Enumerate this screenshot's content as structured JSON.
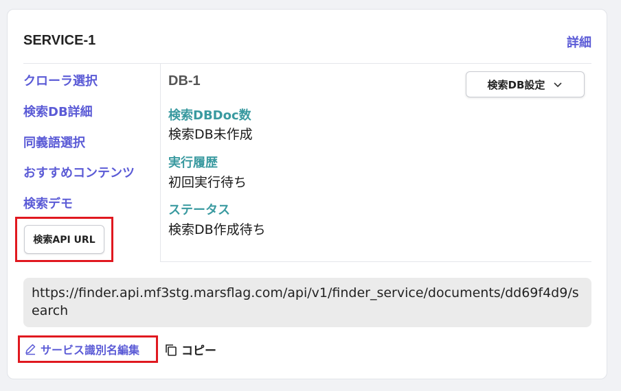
{
  "card": {
    "title": "SERVICE-1",
    "details_label": "詳細"
  },
  "sidebar": {
    "items": [
      {
        "label": "クローラ選択"
      },
      {
        "label": "検索DB詳細"
      },
      {
        "label": "同義語選択"
      },
      {
        "label": "おすすめコンテンツ"
      },
      {
        "label": "検索デモ"
      }
    ],
    "api_url_button": "検索API URL"
  },
  "db": {
    "name": "DB-1",
    "settings_button": "検索DB設定",
    "settings_icon": "chevron-down-icon",
    "fields": [
      {
        "label": "検索DBDoc数",
        "value": "検索DB未作成"
      },
      {
        "label": "実行履歴",
        "value": "初回実行待ち"
      },
      {
        "label": "ステータス",
        "value": "検索DB作成待ち"
      }
    ]
  },
  "url": {
    "text": "https://finder.api.mf3stg.marsflag.com/api/v1/finder_service/documents/dd69f4d9/search"
  },
  "actions": {
    "edit_label": "サービス識別名編集",
    "edit_icon": "pencil-icon",
    "copy_label": "コピー",
    "copy_icon": "copy-icon"
  },
  "colors": {
    "accent": "#5b5bd6",
    "field_label": "#3a9aa0",
    "highlight": "#e0181f"
  }
}
